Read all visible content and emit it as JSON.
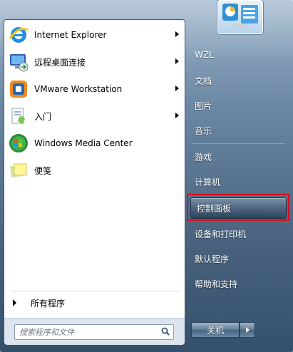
{
  "programs": [
    {
      "label": "Internet Explorer",
      "icon": "internet-explorer-icon",
      "has_arrow": true
    },
    {
      "label": "远程桌面连接",
      "icon": "remote-desktop-icon",
      "has_arrow": true
    },
    {
      "label": "VMware Workstation",
      "icon": "vmware-icon",
      "has_arrow": true
    },
    {
      "label": "入门",
      "icon": "getting-started-icon",
      "has_arrow": true
    },
    {
      "label": "Windows Media Center",
      "icon": "media-center-icon",
      "has_arrow": false
    },
    {
      "label": "便笺",
      "icon": "sticky-notes-icon",
      "has_arrow": false
    }
  ],
  "all_programs_label": "所有程序",
  "search": {
    "placeholder": "搜索程序和文件"
  },
  "right_items": [
    {
      "label": "WZL"
    },
    {
      "label": "文档"
    },
    {
      "label": "图片"
    },
    {
      "label": "音乐"
    },
    {
      "label": "游戏"
    },
    {
      "label": "计算机"
    },
    {
      "label": "控制面板",
      "highlighted": true
    },
    {
      "label": "设备和打印机"
    },
    {
      "label": "默认程序"
    },
    {
      "label": "帮助和支持"
    }
  ],
  "shutdown_label": "关机",
  "colors": {
    "highlight_box": "#d0131b"
  }
}
